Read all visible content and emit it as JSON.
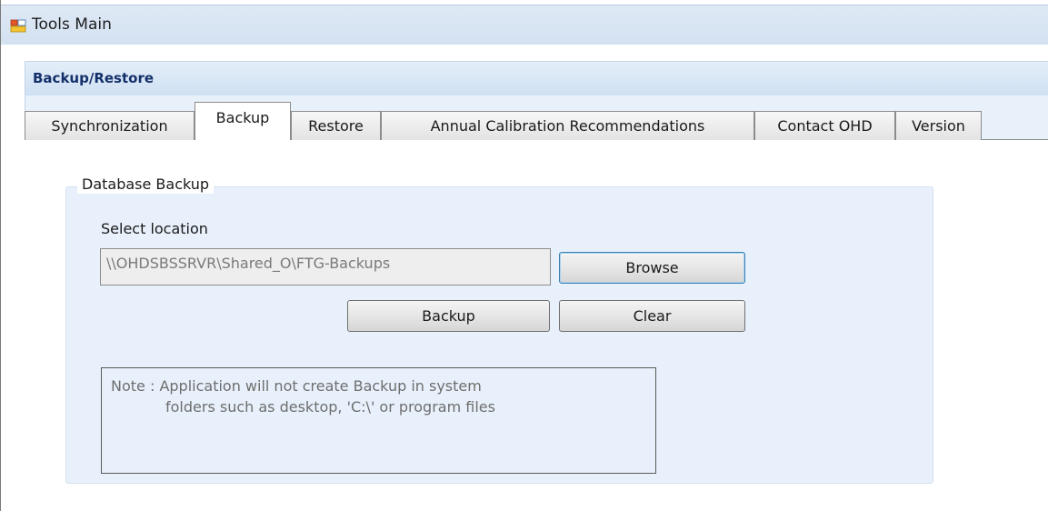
{
  "window": {
    "title": "Tools Main",
    "icon": "app-window-icon"
  },
  "panel": {
    "header": "Backup/Restore"
  },
  "tabs": [
    {
      "label": "Synchronization",
      "active": false
    },
    {
      "label": "Backup",
      "active": true
    },
    {
      "label": "Restore",
      "active": false
    },
    {
      "label": "Annual Calibration Recommendations",
      "active": false
    },
    {
      "label": "Contact OHD",
      "active": false
    },
    {
      "label": "Version",
      "active": false
    }
  ],
  "backup": {
    "group_title": "Database Backup",
    "location_label": "Select location",
    "location_value": "\\\\OHDSBSSRVR\\Shared_O\\FTG-Backups",
    "browse_label": "Browse",
    "backup_label": "Backup",
    "clear_label": "Clear",
    "note_line1": "Note : Application will not create Backup in system",
    "note_line2": "folders such as desktop, 'C:\\' or program files"
  },
  "colors": {
    "header_text": "#14306a",
    "group_bg": "#e8f1fb",
    "focus_border": "#3c7fb1"
  }
}
